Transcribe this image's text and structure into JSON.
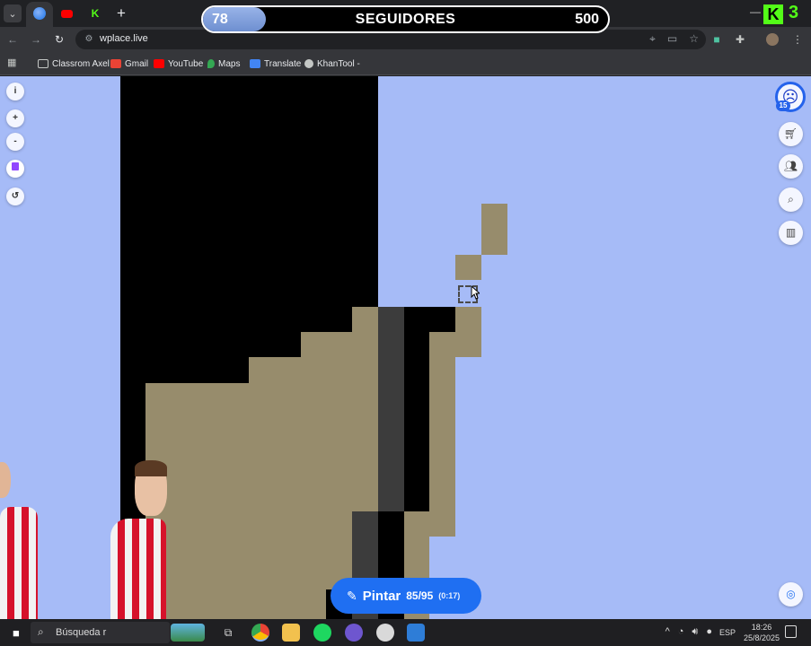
{
  "browser": {
    "url": "wplace.live",
    "bookmarks": [
      "Classrom Axel",
      "Gmail",
      "YouTube",
      "Maps",
      "Translate",
      "KhanTool -"
    ]
  },
  "overlay": {
    "followers_current": "78",
    "followers_title": "SEGUIDORES",
    "followers_goal": "500",
    "followers_progress": 0.156,
    "kick_logo": "K",
    "kick_number": "3"
  },
  "wplace": {
    "left_controls": [
      "i",
      "+",
      "-",
      "twitch-icon",
      "history-icon"
    ],
    "right_controls": [
      "shop-icon",
      "leaderboard-people-icon",
      "search-location-icon",
      "stats-icon"
    ],
    "level": "15",
    "paint_button": {
      "label": "Pintar",
      "count": "85/95",
      "timer": "(0:17)"
    },
    "colors": {
      "sky": "#a6bbf7",
      "black": "#000000",
      "tan": "#978c6c",
      "dark_gray": "#3c3c3c",
      "button": "#1f6ff2"
    }
  },
  "taskbar": {
    "search_text": "Búsqueda r",
    "language": "ESP",
    "time": "18:26",
    "date": "25/8/2025"
  }
}
